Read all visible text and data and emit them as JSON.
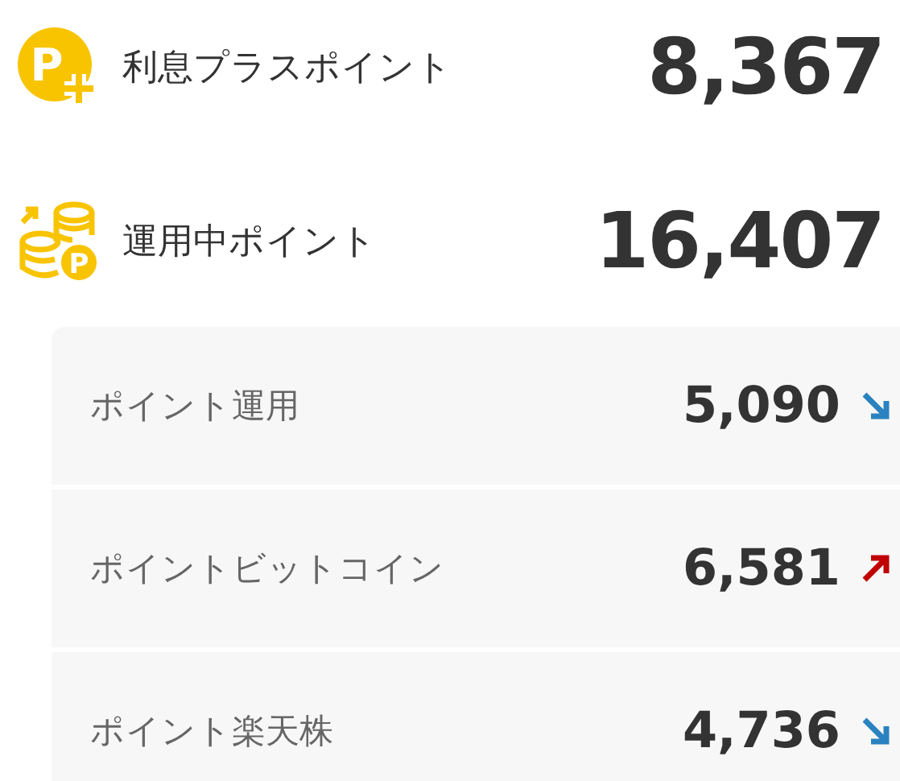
{
  "summary": [
    {
      "kind": "interest",
      "label": "利息プラスポイント",
      "value": "8,367",
      "icon_letter": "P"
    },
    {
      "kind": "invest",
      "label": "運用中ポイント",
      "value": "16,407",
      "icon_letter": "P"
    }
  ],
  "breakdown": [
    {
      "label": "ポイント運用",
      "value": "5,090",
      "kind": "down"
    },
    {
      "label": "ポイントビットコイン",
      "value": "6,581",
      "kind": "up"
    },
    {
      "label": "ポイント楽天株",
      "value": "4,736",
      "kind": "down"
    }
  ]
}
